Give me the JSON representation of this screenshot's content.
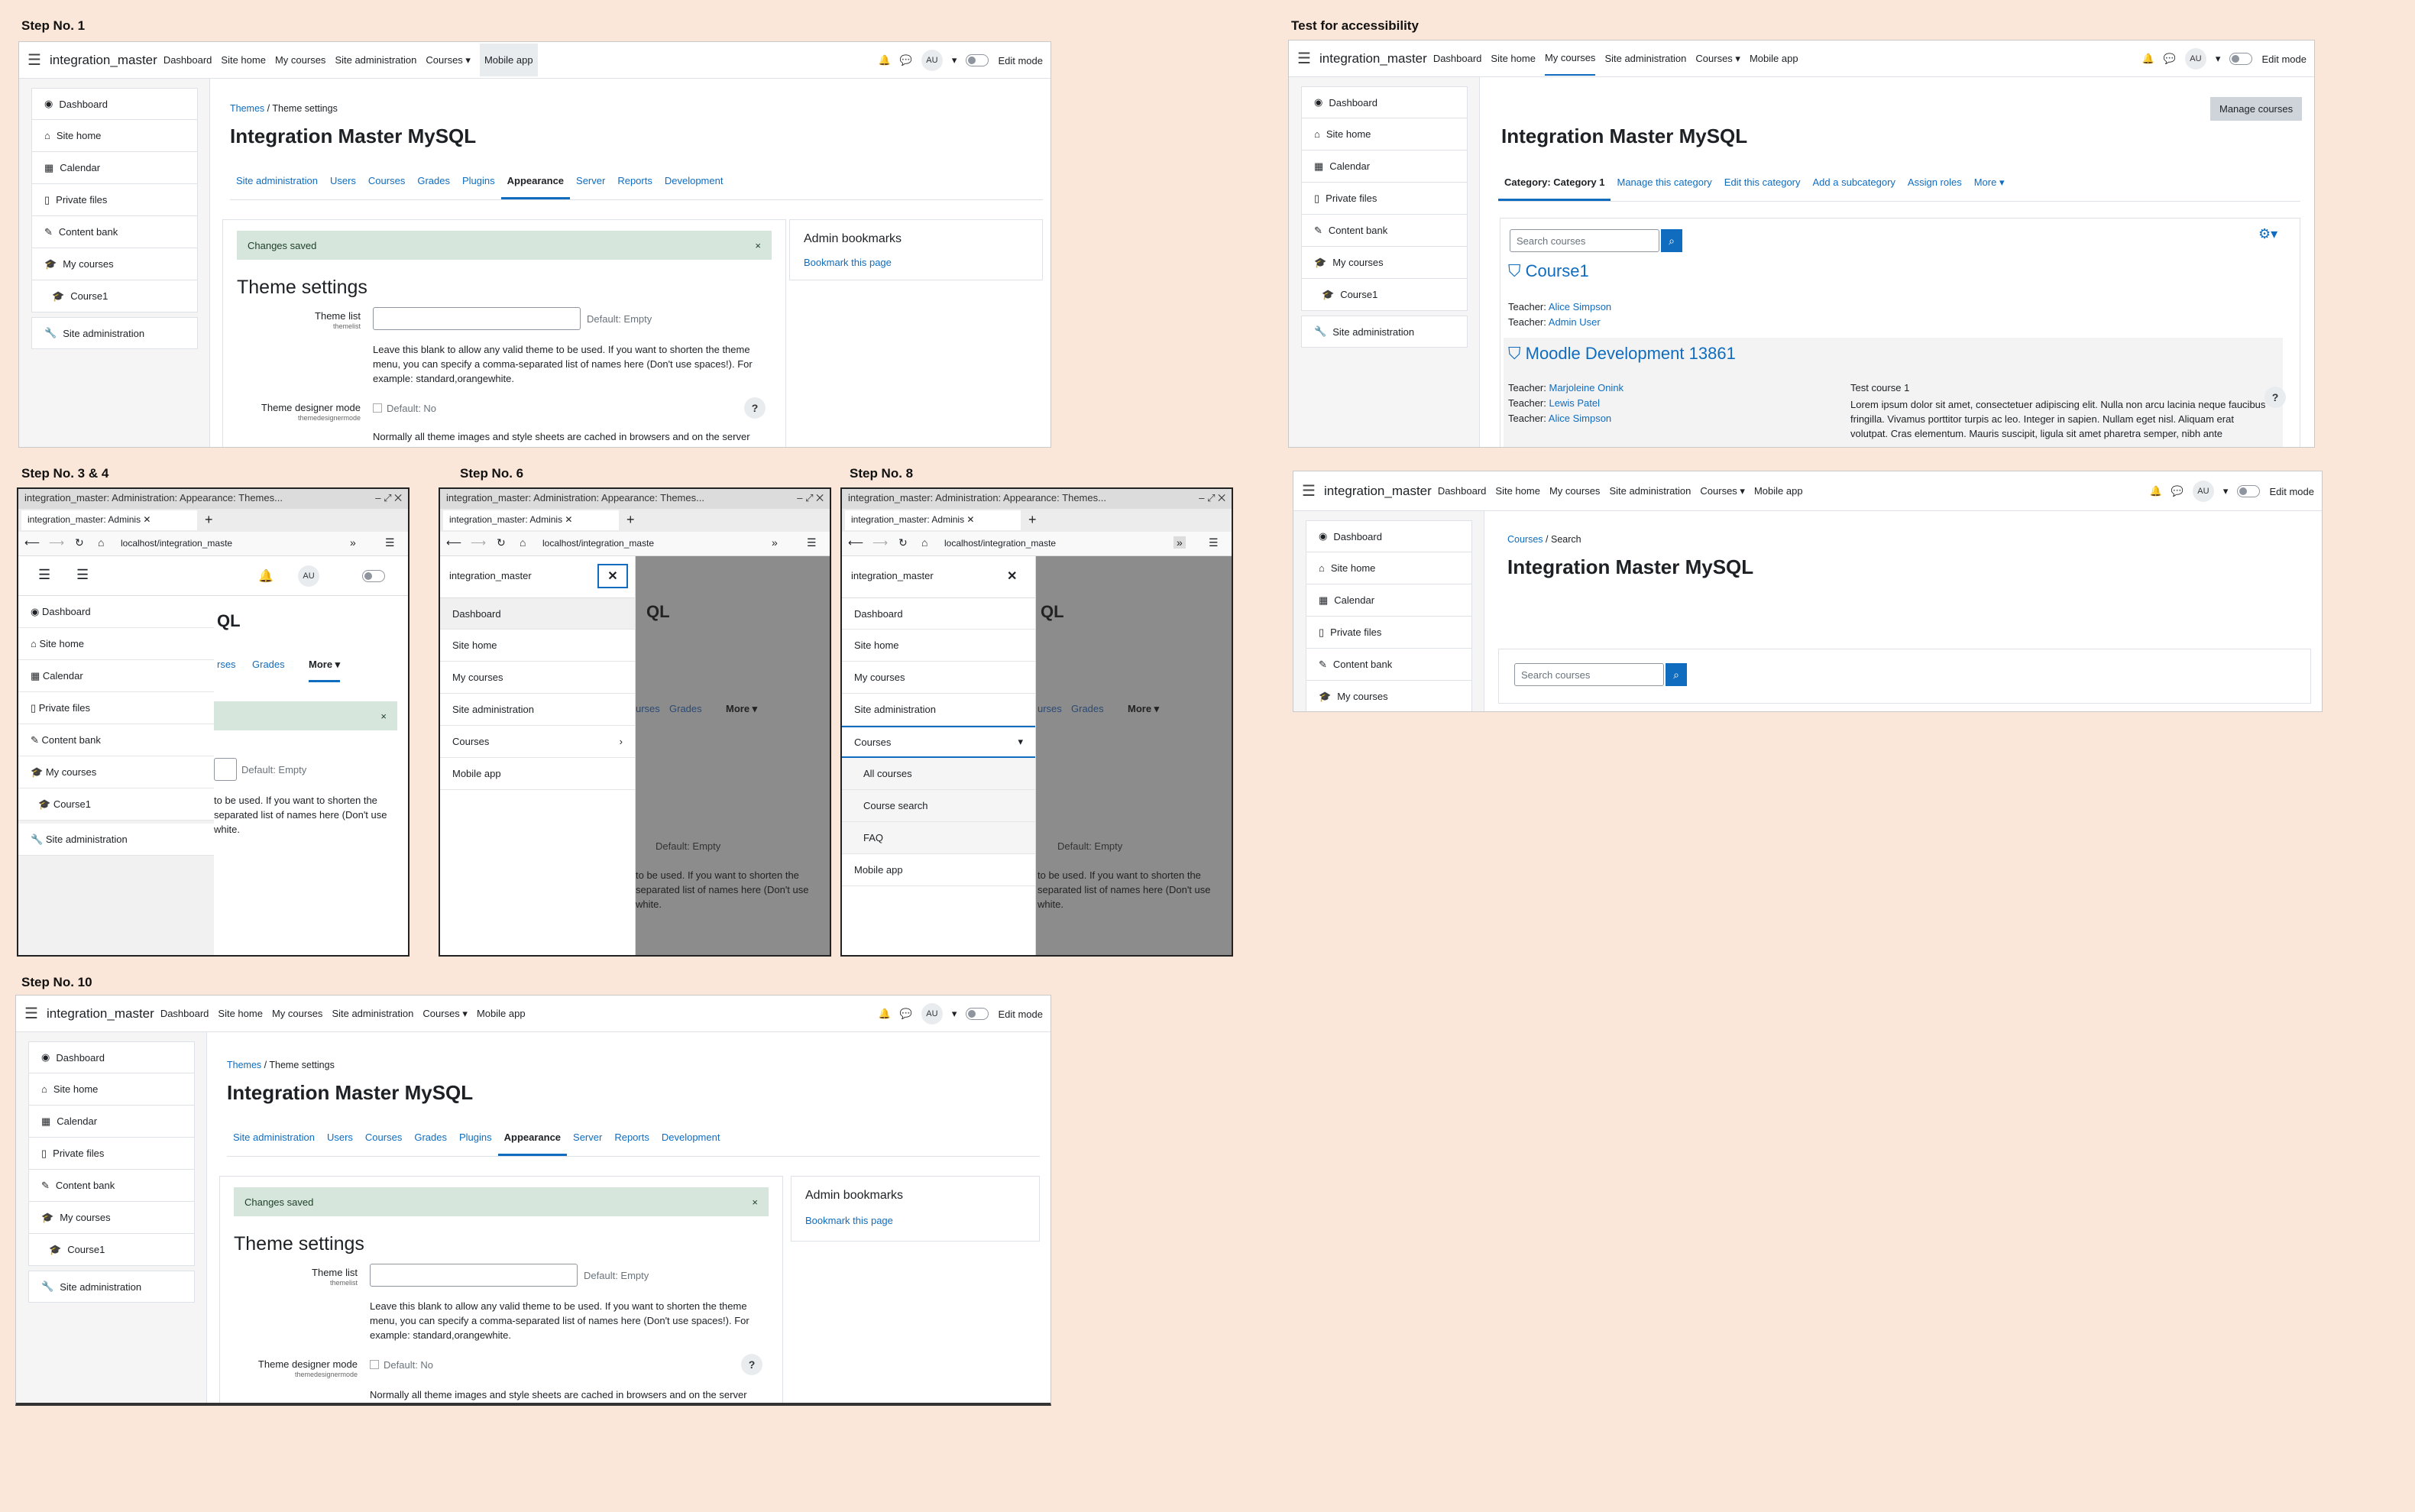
{
  "labels": {
    "step1": "Step No. 1",
    "step34": "Step No. 3 & 4",
    "step6": "Step No. 6",
    "step8": "Step No. 8",
    "step10": "Step No. 10",
    "accessibility": "Test for accessibility"
  },
  "navbar": {
    "brand": "integration_master",
    "links": [
      "Dashboard",
      "Site home",
      "My courses",
      "Site administration",
      "Courses",
      "Mobile app"
    ],
    "avatar": "AU",
    "edit_mode": "Edit mode"
  },
  "drawer": {
    "items": [
      "Dashboard",
      "Site home",
      "Calendar",
      "Private files",
      "Content bank",
      "My courses",
      "Course1",
      "Site administration"
    ]
  },
  "theme_page": {
    "breadcrumb_1": "Themes",
    "breadcrumb_sep": "/",
    "breadcrumb_2": "Theme settings",
    "title": "Integration Master MySQL",
    "tabs": [
      "Site administration",
      "Users",
      "Courses",
      "Grades",
      "Plugins",
      "Appearance",
      "Server",
      "Reports",
      "Development"
    ],
    "alert": "Changes saved",
    "close": "×",
    "heading": "Theme settings",
    "theme_list_label": "Theme list",
    "theme_list_sub": "themelist",
    "default_empty": "Default: Empty",
    "theme_list_desc": "Leave this blank to allow any valid theme to be used. If you want to shorten the theme menu, you can specify a comma-separated list of names here (Don't use spaces!). For example: standard,orangewhite.",
    "designer_label": "Theme designer mode",
    "designer_sub": "themedesignermode",
    "default_no": "Default: No",
    "designer_desc": "Normally all theme images and style sheets are cached in browsers and on the server",
    "bookmarks_title": "Admin bookmarks",
    "bookmark_link": "Bookmark this page",
    "help": "?"
  },
  "browser": {
    "window_title": "integration_master: Administration: Appearance: Themes...",
    "tab_title": "integration_master: Adminis",
    "url": "localhost/integration_maste",
    "new_tab": "+"
  },
  "mobile": {
    "title_fragment": "QL",
    "tabs_fragment": [
      "rses",
      "Grades",
      "More"
    ],
    "courses_fragment": "urses",
    "desc_fragment": "to be used. If you want to shorten the separated list of names here (Don't use white.",
    "drawer_title": "integration_master",
    "menu": [
      "Dashboard",
      "Site home",
      "My courses",
      "Site administration",
      "Courses",
      "Mobile app"
    ],
    "courses_sub": [
      "All courses",
      "Course search",
      "FAQ"
    ]
  },
  "accessibility": {
    "manage_courses": "Manage courses",
    "title": "Integration Master MySQL",
    "tabs": [
      "Category: Category 1",
      "Manage this category",
      "Edit this category",
      "Add a subcategory",
      "Assign roles",
      "More"
    ],
    "search_placeholder": "Search courses",
    "course1": "Course1",
    "teacher_label": "Teacher:",
    "course1_teachers": [
      "Alice Simpson",
      "Admin User"
    ],
    "course2": "Moodle Development 13861",
    "course2_teachers": [
      "Marjoleine Onink",
      "Lewis Patel",
      "Alice Simpson"
    ],
    "course2_summary_title": "Test course 1",
    "course2_summary": "Lorem ipsum dolor sit amet, consectetuer adipiscing elit. Nulla non arcu lacinia neque faucibus fringilla. Vivamus porttitor turpis ac leo. Integer in sapien. Nullam eget nisl. Aliquam erat volutpat. Cras elementum. Mauris suscipit, ligula sit amet pharetra semper, nibh ante"
  },
  "search_page": {
    "breadcrumb_1": "Courses",
    "breadcrumb_2": "Search",
    "title": "Integration Master MySQL",
    "search_placeholder": "Search courses"
  },
  "colors": {
    "accent": "#0f6cbf",
    "background": "#fbe7d9",
    "alert": "#d7e6dc"
  }
}
